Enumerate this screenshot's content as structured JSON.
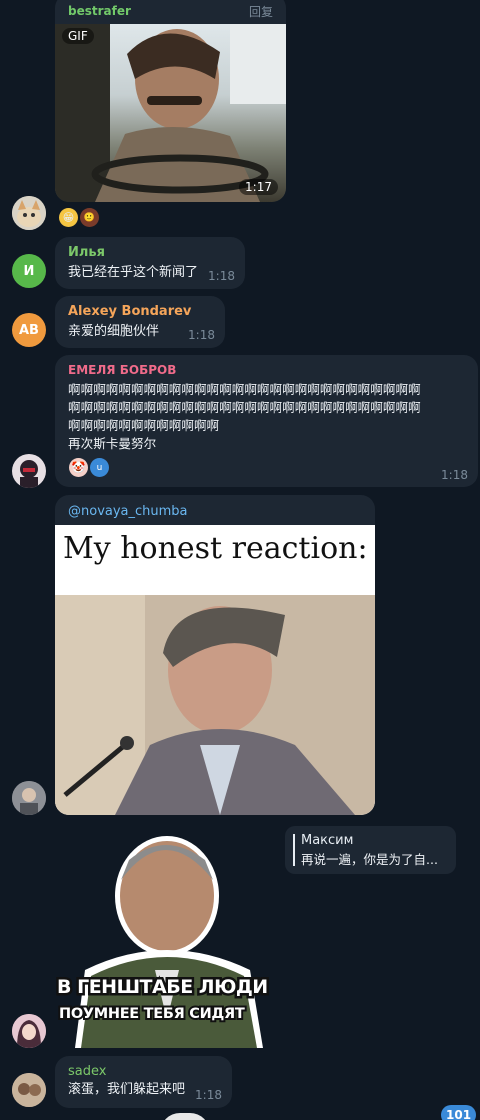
{
  "messages": {
    "m1": {
      "sender": "bestrafer",
      "reply_label": "回复",
      "gif_label": "GIF",
      "duration": "1:17",
      "color": "#72c96a"
    },
    "m2": {
      "sender": "Илья",
      "avatar_letter": "И",
      "text": "我已经在乎这个新闻了",
      "time": "1:18",
      "color": "#7cc86a",
      "avatar_color": "#57b84a"
    },
    "m3": {
      "sender": "Alexey Bondarev",
      "avatar_letters": "AB",
      "text": "亲爱的细胞伙伴",
      "time": "1:18",
      "color": "#f5a55a",
      "avatar_color": "#f09a3e"
    },
    "m4": {
      "sender": "ЕМЕЛЯ БОБРОВ",
      "line1": "啊啊啊啊啊啊啊啊啊啊啊啊啊啊啊啊啊啊啊啊啊啊啊啊啊啊啊啊",
      "line2": "啊啊啊啊啊啊啊啊啊啊啊啊啊啊啊啊啊啊啊啊啊啊啊啊啊啊啊啊",
      "line3": "啊啊啊啊啊啊啊啊啊啊啊啊",
      "line4": "再次斯卡曼努尔",
      "time": "1:18",
      "color": "#f06b8a",
      "reaction_letter": "u"
    },
    "m5": {
      "sender": "@novaya_chumba",
      "meme_caption": "My honest reaction:",
      "color": "#6ab7f0"
    },
    "m6": {
      "reply_name": "Максим",
      "reply_text": "再说一遍，你是为了自...",
      "sticker_line1": "В ГЕНШТАБЕ ЛЮДИ",
      "sticker_line2": "ПОУМНЕЕ ТЕБЯ СИДЯТ"
    },
    "m7": {
      "sender": "sadex",
      "text": "滚蛋，我们躲起来吧",
      "time": "1:18",
      "color": "#7cc86a"
    }
  },
  "unread_badge": "101",
  "colors": {
    "background": "#0f1823",
    "bubble": "#1d2733",
    "accent": "#3a8ad8"
  }
}
